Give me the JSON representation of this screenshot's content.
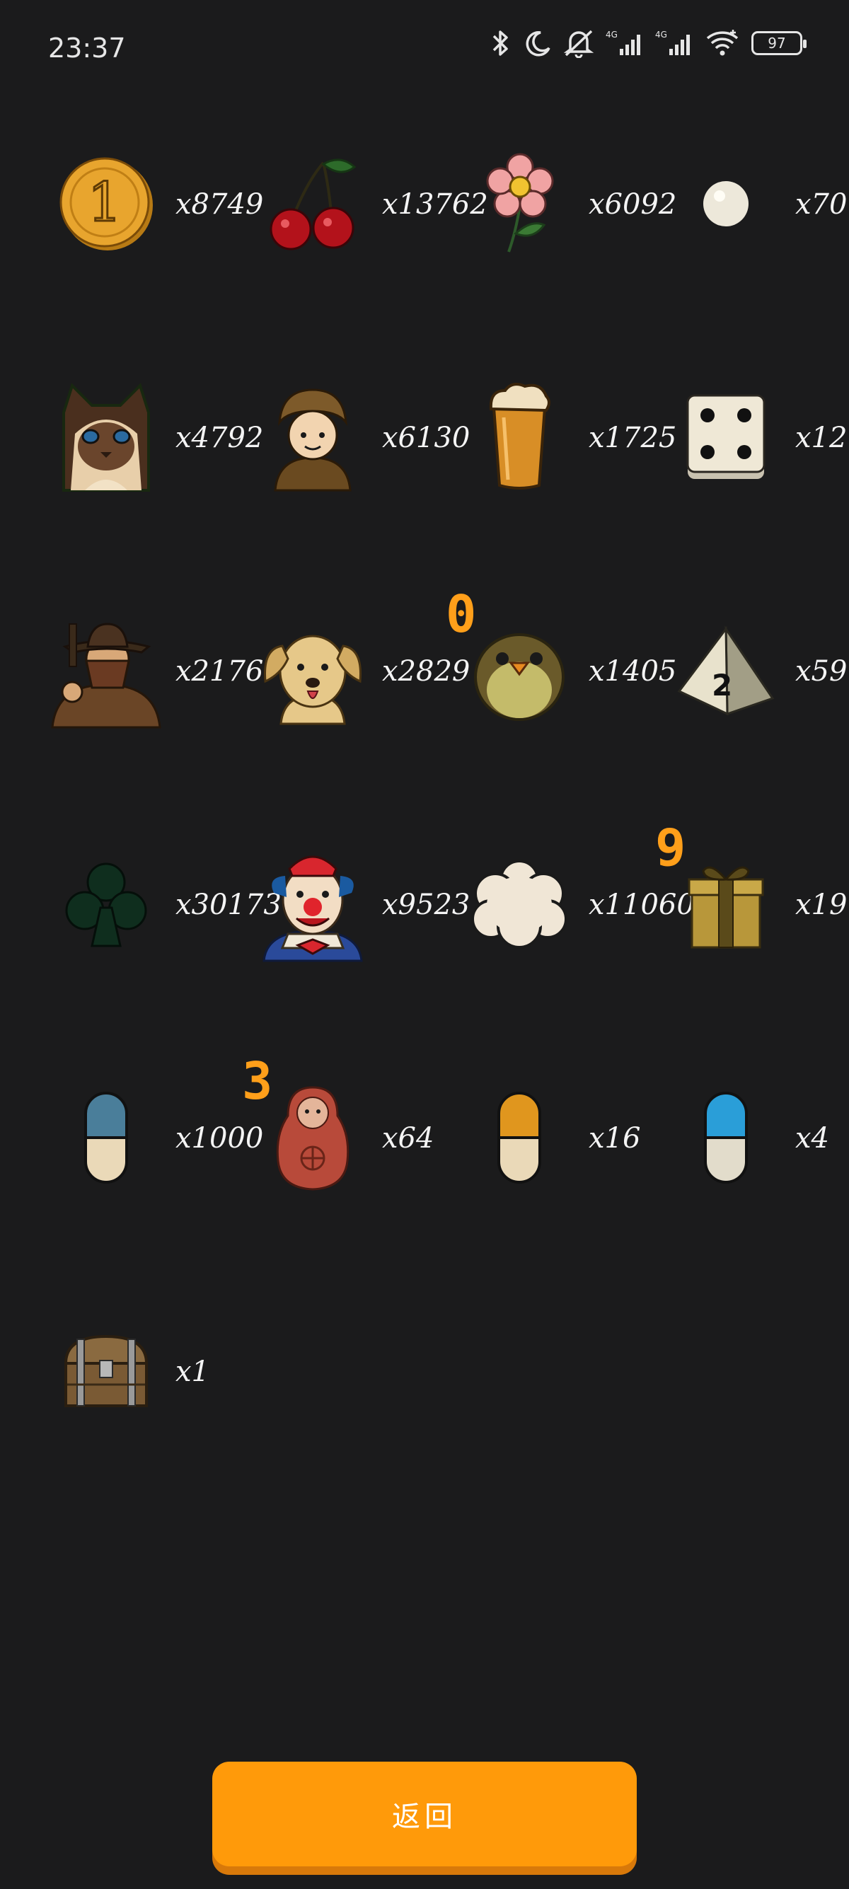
{
  "status_bar": {
    "time": "23:37",
    "battery": "97",
    "icons": [
      "bluetooth-icon",
      "moon-icon",
      "mute-icon",
      "signal-4g-icon",
      "signal-4g-icon",
      "wifi-icon",
      "battery-icon"
    ]
  },
  "items": [
    {
      "icon": "coin-icon",
      "count": "x8749"
    },
    {
      "icon": "cherries-icon",
      "count": "x13762"
    },
    {
      "icon": "flower-icon",
      "count": "x6092"
    },
    {
      "icon": "pearl-icon",
      "count": "x70"
    },
    {
      "icon": "cat-icon",
      "count": "x4792"
    },
    {
      "icon": "boy-icon",
      "count": "x6130"
    },
    {
      "icon": "beer-icon",
      "count": "x1725"
    },
    {
      "icon": "dice-icon",
      "count": "x12"
    },
    {
      "icon": "bandit-icon",
      "count": "x2176"
    },
    {
      "icon": "dog-icon",
      "count": "x2829"
    },
    {
      "icon": "bird-icon",
      "count": "x1405"
    },
    {
      "icon": "d4-dice-icon",
      "count": "x59"
    },
    {
      "icon": "club-icon",
      "count": "x30173"
    },
    {
      "icon": "clown-icon",
      "count": "x9523"
    },
    {
      "icon": "cloud-icon",
      "count": "x11060"
    },
    {
      "icon": "gift-icon",
      "count": "x19"
    },
    {
      "icon": "blue-pill-icon",
      "count": "x1000"
    },
    {
      "icon": "matryoshka-icon",
      "count": "x64"
    },
    {
      "icon": "orange-pill-icon",
      "count": "x16"
    },
    {
      "icon": "cyan-pill-icon",
      "count": "x4"
    },
    {
      "icon": "chest-icon",
      "count": "x1"
    }
  ],
  "overlays": [
    {
      "value": "0",
      "color": "#ff9f1a"
    },
    {
      "value": "9",
      "color": "#ff9f1a"
    },
    {
      "value": "3",
      "color": "#ff9f1a"
    }
  ],
  "back_button": {
    "label": "返回",
    "color": "#ff9a0a"
  }
}
